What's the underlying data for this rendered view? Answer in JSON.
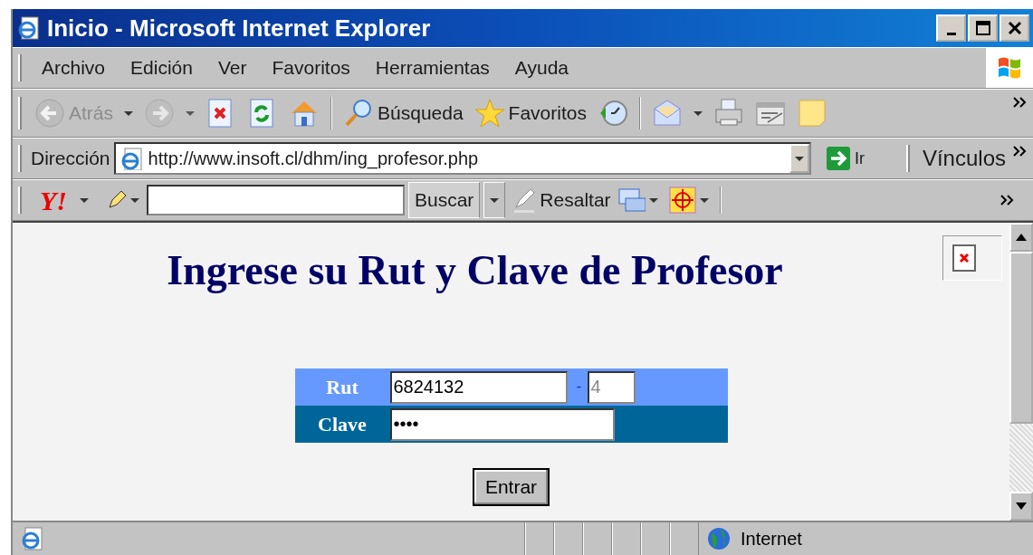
{
  "window": {
    "title": "Inicio - Microsoft Internet Explorer"
  },
  "menu": [
    "Archivo",
    "Edición",
    "Ver",
    "Favoritos",
    "Herramientas",
    "Ayuda"
  ],
  "toolbar": [
    {
      "kind": "nav",
      "label": "Atrás",
      "disabled": true,
      "dropdown": true
    },
    {
      "kind": "nav",
      "disabled": true,
      "dropdown": true
    },
    {
      "kind": "icon"
    },
    {
      "kind": "icon"
    },
    {
      "kind": "icon"
    },
    {
      "kind": "separator"
    },
    {
      "kind": "icon",
      "label": "Búsqueda"
    },
    {
      "kind": "icon",
      "label": "Favoritos"
    },
    {
      "kind": "icon"
    },
    {
      "kind": "separator"
    },
    {
      "kind": "icon",
      "dropdown": true
    },
    {
      "kind": "icon"
    },
    {
      "kind": "icon"
    },
    {
      "kind": "icon"
    }
  ],
  "address": {
    "label": "Dirección",
    "url": "http://www.insoft.cl/dhm/ing_profesor.php",
    "go": "Ir",
    "links": "Vínculos"
  },
  "yahoo_bar": {
    "logo": "Y!",
    "search_button": "Buscar",
    "highlight": "Resaltar"
  },
  "page": {
    "heading": "Ingrese su Rut y Clave de Profesor",
    "form": [
      {
        "kind": "rut",
        "label": "Rut",
        "value": "6824132",
        "separator": "-",
        "check_digit": "4",
        "color": "#6699ff"
      },
      {
        "kind": "password",
        "label": "Clave",
        "value": "••••",
        "color": "#006699"
      }
    ],
    "submit": "Entrar"
  },
  "status_bar": {
    "zone": "Internet"
  }
}
